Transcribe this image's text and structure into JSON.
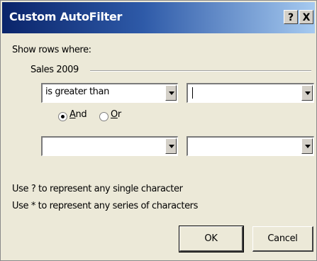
{
  "dialog": {
    "title": "Custom AutoFilter",
    "help_glyph": "?",
    "close_glyph": "X",
    "show_rows_label": "Show rows where:",
    "field_label": "Sales 2009",
    "row1": {
      "operator": "is greater than",
      "value": ""
    },
    "logic": {
      "and_prefix": "A",
      "and_rest": "nd",
      "or_prefix": "O",
      "or_rest": "r",
      "selected": "And"
    },
    "row2": {
      "operator": "",
      "value": ""
    },
    "hint1": "Use ? to represent any single character",
    "hint2": "Use * to represent any series of characters",
    "ok_label": "OK",
    "cancel_label": "Cancel"
  }
}
